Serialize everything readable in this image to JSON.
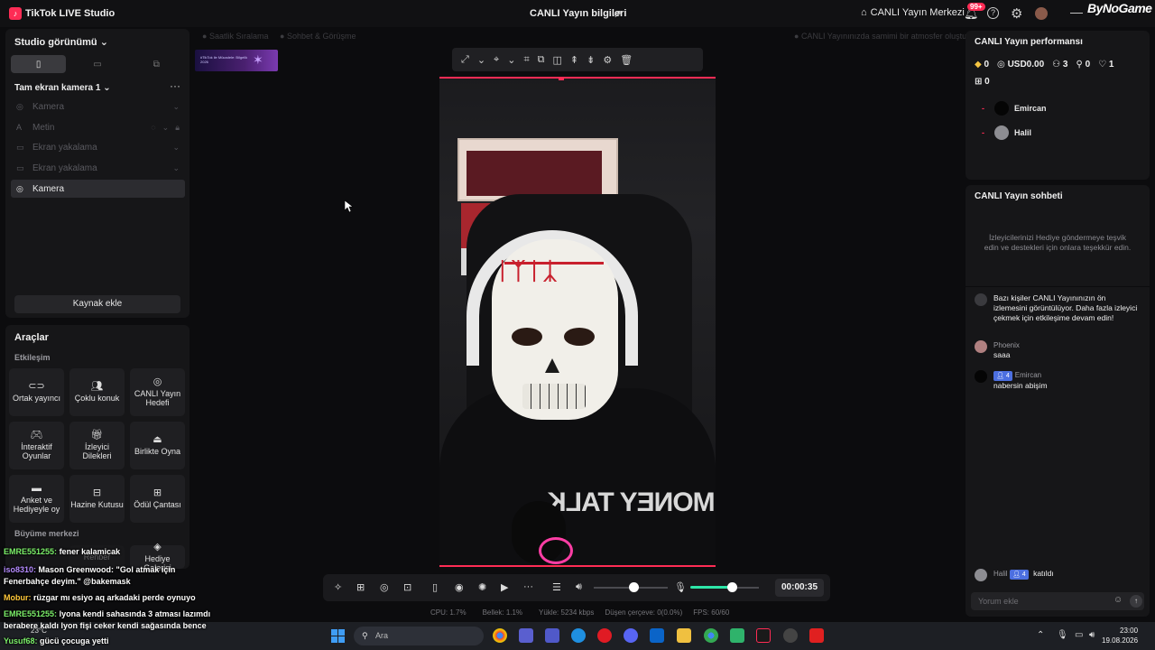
{
  "titlebar": {
    "app_title": "TikTok LIVE Studio",
    "live_info": "CANLI Yayın bilgileri",
    "live_center": "CANLI Yayın Merkezi",
    "notification_badge": "99+",
    "watermark": "ByNoGame"
  },
  "left": {
    "studio_view": "Studio görünümü",
    "scene_name": "Tam ekran kamera 1",
    "sources": [
      {
        "label": "Kamera"
      },
      {
        "label": "Metin"
      },
      {
        "label": "Ekran yakalama"
      },
      {
        "label": "Ekran yakalama"
      },
      {
        "label": "Kamera"
      }
    ],
    "add_source": "Kaynak ekle"
  },
  "tools": {
    "title": "Araçlar",
    "interaction": "Etkileşim",
    "items": [
      {
        "label": "Ortak yayıncı"
      },
      {
        "label": "Çoklu konuk"
      },
      {
        "label": "CANLI Yayın Hedefi"
      },
      {
        "label": "İnteraktif Oyunlar"
      },
      {
        "label": "İzleyici Dilekleri"
      },
      {
        "label": "Birlikte Oyna"
      },
      {
        "label": "Anket ve Hediyeyle oy"
      },
      {
        "label": "Hazine Kutusu"
      },
      {
        "label": "Ödül Çantası"
      },
      {
        "label": "Rehber"
      },
      {
        "label": "Hediye Galerisi"
      }
    ],
    "growth": "Büyüme merkezi"
  },
  "stage": {
    "tab_left": "Saatlik Sıralama",
    "tab_right": "Sohbet & Görüşme",
    "thumb_text": "#TikTok ile Mücadele: Bilgelik 2026",
    "notice": "CANLI Yayınınızda samimi bir atmosfer oluştur",
    "shirt_text": "MONEY TALK"
  },
  "controls": {
    "timer": "00:00:35"
  },
  "stats": {
    "cpu": "CPU: 1.7%",
    "memory": "Bellek: 1.1%",
    "upload": "Yükle: 5234 kbps",
    "dropped": "Düşen çerçeve: 0(0.0%)",
    "fps": "FPS: 60/60"
  },
  "perf": {
    "title": "CANLI Yayın performansı",
    "diamonds": "0",
    "usd": "USD0.00",
    "viewers": "3",
    "new_followers": "0",
    "likes": "1",
    "gifts": "0",
    "top_viewers": [
      {
        "name": "Emircan"
      },
      {
        "name": "Halil"
      }
    ]
  },
  "chat": {
    "title": "CANLI Yayın sohbeti",
    "empty_text": "İzleyicilerinizi Hediye göndermeye teşvik edin ve destekleri için onlara teşekkür edin.",
    "system_msg": "Bazı kişiler CANLI Yayınınızın ön izlemesini görüntülüyor. Daha fazla izleyici çekmek için etkileşime devam edin!",
    "messages": [
      {
        "name": "Phoenix",
        "text": "saaa"
      },
      {
        "name": "Emircan",
        "level": "4",
        "text": "nabersin abişim"
      }
    ],
    "join_name": "Halil",
    "join_level": "4",
    "join_text": "katıldı",
    "input_placeholder": "Yorum ekle"
  },
  "overlay_chat": [
    {
      "user": "EMRE551255:",
      "text": "fener kalamicak"
    },
    {
      "user": "iso8310:",
      "text": "Mason Greenwood: \"Gol atmak için"
    },
    {
      "user": "",
      "text": "Fenerbahçe deyim.\" @bakemask"
    },
    {
      "user": "Mobur:",
      "text": "rüzgar mı esiyo aq arkadaki perde oynuyo"
    },
    {
      "user": "EMRE551255:",
      "text": "lyona kendi sahasında 3 atması lazımdı"
    },
    {
      "user": "",
      "text": "berabere kaldı lyon fişi ceker kendi sağasında bence"
    },
    {
      "user": "Yusuf68:",
      "text": "gücü çocuga yetti"
    }
  ],
  "taskbar": {
    "search_placeholder": "Ara",
    "weather": "23°C",
    "time": "23:00",
    "date": "19.08.2026"
  }
}
